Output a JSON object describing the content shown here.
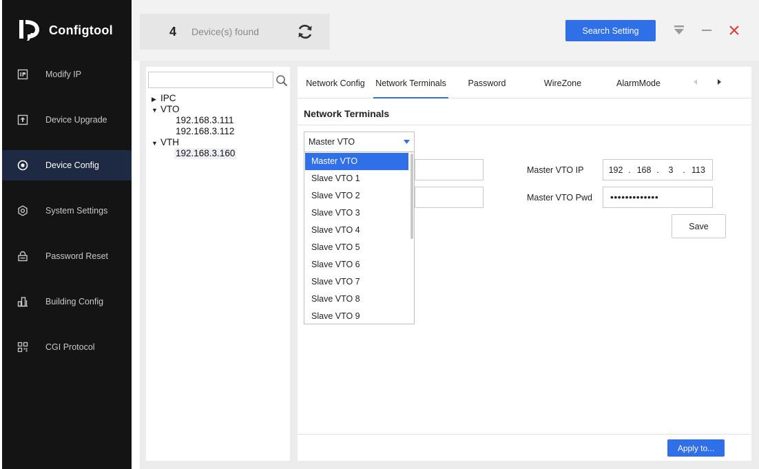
{
  "app": {
    "name": "Configtool"
  },
  "sidebar": {
    "items": [
      {
        "label": "Modify IP",
        "icon": "ip-icon"
      },
      {
        "label": "Device Upgrade",
        "icon": "upload-icon"
      },
      {
        "label": "Device Config",
        "icon": "target-icon",
        "active": true
      },
      {
        "label": "System Settings",
        "icon": "gear-icon"
      },
      {
        "label": "Password Reset",
        "icon": "lock-icon"
      },
      {
        "label": "Building Config",
        "icon": "building-icon"
      },
      {
        "label": "CGI Protocol",
        "icon": "qr-icon"
      }
    ]
  },
  "header": {
    "device_count": "4",
    "device_found_label": "Device(s) found",
    "search_setting_label": "Search Setting"
  },
  "tree": {
    "search_placeholder": "",
    "groups": [
      {
        "label": "IPC",
        "expanded": false,
        "children": []
      },
      {
        "label": "VTO",
        "expanded": true,
        "children": [
          "192.168.3.111",
          "192.168.3.112"
        ]
      },
      {
        "label": "VTH",
        "expanded": true,
        "children": [
          "192.168.3.160"
        ]
      }
    ]
  },
  "tabs": [
    {
      "label": "Network Config"
    },
    {
      "label": "Network Terminals",
      "active": true
    },
    {
      "label": "Password"
    },
    {
      "label": "WireZone"
    },
    {
      "label": "AlarmMode"
    }
  ],
  "section": {
    "title": "Network Terminals"
  },
  "form": {
    "select_value": "Master VTO",
    "master_vto_ip_label": "Master VTO IP",
    "master_vto_ip": [
      "192",
      "168",
      "3",
      "113"
    ],
    "master_vto_pwd_label": "Master VTO Pwd",
    "master_vto_pwd": "•••••••••••••",
    "save_label": "Save",
    "apply_label": "Apply to..."
  },
  "dropdown": {
    "options": [
      "Master VTO",
      "Slave VTO 1",
      "Slave VTO 2",
      "Slave VTO 3",
      "Slave VTO 4",
      "Slave VTO 5",
      "Slave VTO 6",
      "Slave VTO 7",
      "Slave VTO 8",
      "Slave VTO 9"
    ],
    "selected_index": 0
  },
  "colors": {
    "accent": "#2f6fe8",
    "sidebar_bg": "#141414",
    "sidebar_active": "#1e2a44",
    "close": "#e0403a"
  }
}
